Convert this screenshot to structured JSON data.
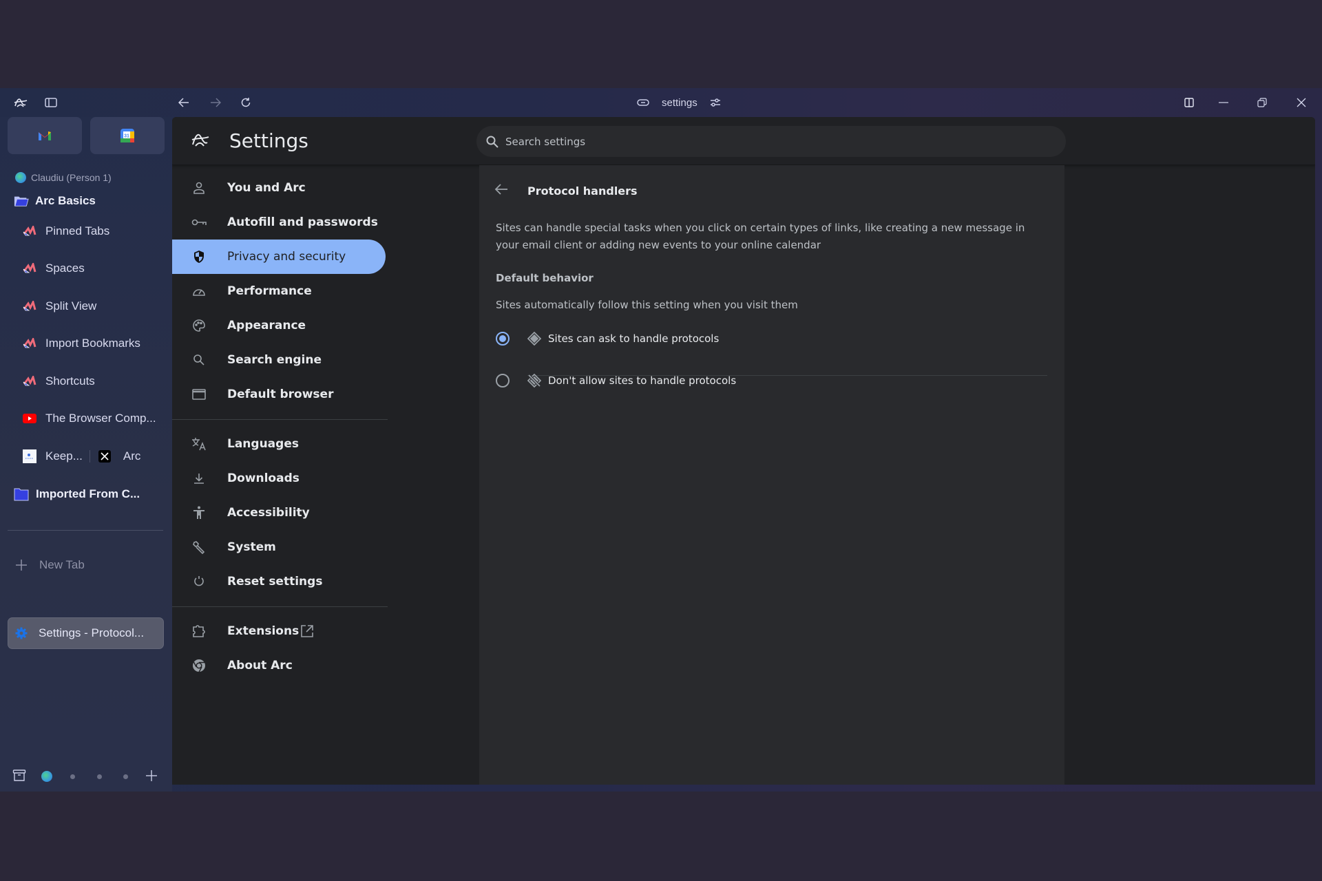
{
  "topbar": {
    "url_text": "settings",
    "icons": [
      "arc-logo-icon",
      "sidebar-toggle-icon",
      "back-icon",
      "forward-icon",
      "reload-icon",
      "link-icon",
      "site-controls-icon",
      "split-view-icon",
      "minimize-icon",
      "restore-icon",
      "close-icon"
    ]
  },
  "sidebar": {
    "pinned": [
      {
        "name": "Gmail",
        "icon": "gmail-icon"
      },
      {
        "name": "Google Calendar",
        "icon": "calendar-icon",
        "day": "31"
      }
    ],
    "profile": "Claudiu (Person 1)",
    "folders": [
      {
        "label": "Arc Basics",
        "open": true,
        "items": [
          {
            "label": "Pinned Tabs"
          },
          {
            "label": "Spaces"
          },
          {
            "label": "Split View"
          },
          {
            "label": "Import Bookmarks"
          },
          {
            "label": "Shortcuts"
          },
          {
            "label": "The Browser Comp..."
          },
          {
            "label": "Keep...",
            "split_with": "Arc"
          }
        ]
      },
      {
        "label": "Imported From C...",
        "open": false
      }
    ],
    "new_tab": "New Tab",
    "active_tab": "Settings - Protocol..."
  },
  "settings": {
    "title": "Settings",
    "search_placeholder": "Search settings",
    "nav": [
      {
        "label": "You and Arc",
        "icon": "person-icon"
      },
      {
        "label": "Autofill and passwords",
        "icon": "key-icon"
      },
      {
        "label": "Privacy and security",
        "icon": "shield-icon",
        "selected": true
      },
      {
        "label": "Performance",
        "icon": "speedometer-icon"
      },
      {
        "label": "Appearance",
        "icon": "palette-icon"
      },
      {
        "label": "Search engine",
        "icon": "search-icon"
      },
      {
        "label": "Default browser",
        "icon": "browser-window-icon"
      },
      {
        "label": "Languages",
        "icon": "translate-icon"
      },
      {
        "label": "Downloads",
        "icon": "download-icon"
      },
      {
        "label": "Accessibility",
        "icon": "accessibility-icon"
      },
      {
        "label": "System",
        "icon": "wrench-icon"
      },
      {
        "label": "Reset settings",
        "icon": "reset-icon"
      },
      {
        "label": "Extensions",
        "icon": "puzzle-icon"
      },
      {
        "label": "About Arc",
        "icon": "chrome-icon"
      }
    ],
    "page": {
      "title": "Protocol handlers",
      "description": "Sites can handle special tasks when you click on certain types of links, like creating a new message in your email client or adding new events to your online calendar",
      "section_title": "Default behavior",
      "section_subtitle": "Sites automatically follow this setting when you visit them",
      "options": [
        {
          "label": "Sites can ask to handle protocols",
          "selected": true
        },
        {
          "label": "Don't allow sites to handle protocols",
          "selected": false
        }
      ]
    }
  },
  "colors": {
    "accent": "#8ab4f8",
    "page_bg": "#202124",
    "card_bg": "#292a2d",
    "sidebar_bg": "#262e4a"
  }
}
